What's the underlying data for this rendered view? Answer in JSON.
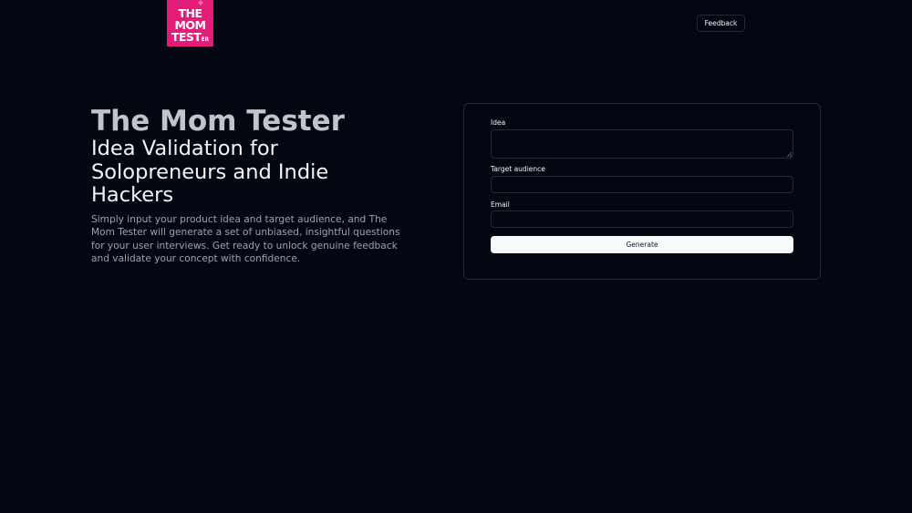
{
  "logo": {
    "line1": "THE",
    "line2": "MOM",
    "line3": "TEST",
    "line3_suffix": "ER",
    "brand_color": "#e31c79"
  },
  "header": {
    "feedback_label": "Feedback"
  },
  "hero": {
    "title": "The Mom Tester",
    "subtitle": "Idea Validation for Solopreneurs and Indie Hackers",
    "description": "Simply input your product idea and target audience, and The Mom Tester will generate a set of unbiased, insightful questions for your user interviews. Get ready to unlock genuine feedback and validate your concept with confidence."
  },
  "form": {
    "idea_label": "Idea",
    "idea_value": "",
    "audience_label": "Target audience",
    "audience_value": "",
    "email_label": "Email",
    "email_value": "",
    "submit_label": "Generate"
  },
  "colors": {
    "background": "#030712",
    "border": "#1f2937",
    "button_bg": "#f9fafb"
  }
}
